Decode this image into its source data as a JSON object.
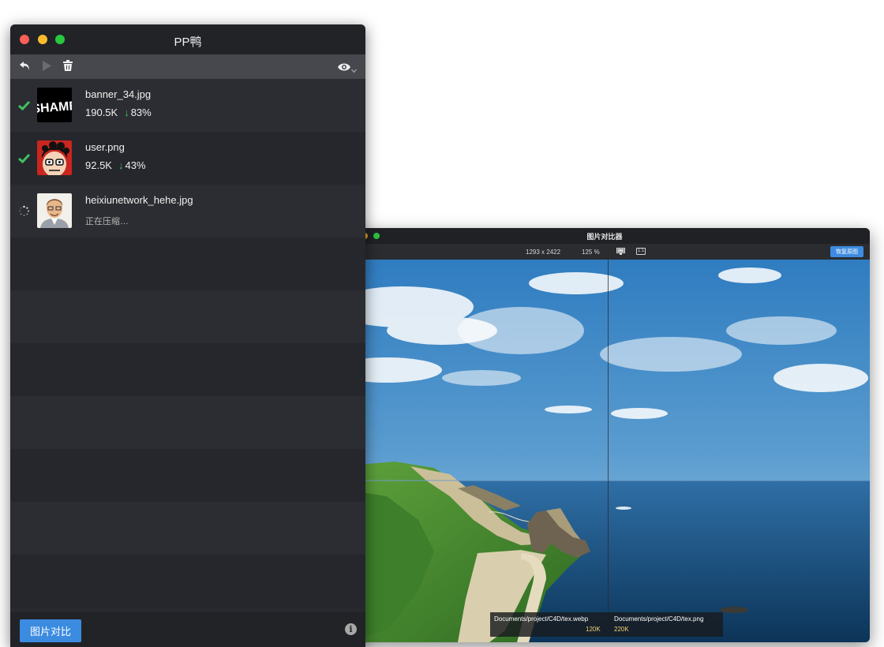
{
  "main_window": {
    "title": "PP鸭",
    "toolbar": {
      "icons": [
        "undo-icon",
        "play-icon",
        "trash-icon",
        "eye-icon",
        "chevron-down-icon"
      ]
    },
    "files": [
      {
        "name": "banner_34.jpg",
        "size": "190.5K",
        "reduction": "83%",
        "status": "done",
        "thumb": "shame-logo"
      },
      {
        "name": "user.png",
        "size": "92.5K",
        "reduction": "43%",
        "status": "done",
        "thumb": "cartoon-face"
      },
      {
        "name": "heixiunetwork_hehe.jpg",
        "status": "compressing",
        "status_text": "正在压缩…",
        "thumb": "portrait-sketch"
      }
    ],
    "thumb_texts": {
      "shame": "SHAME"
    },
    "compare_button": "图片对比",
    "info_icon": "i",
    "colors": {
      "accent": "#3b8be0",
      "success": "#3fc060"
    }
  },
  "compare_window": {
    "title": "图片对比器",
    "dimensions": "1293 x 2422",
    "zoom": "125 %",
    "one_to_one": "1:1",
    "restore_button": "恢复原图",
    "left_file": {
      "path": "Documents/project/C4D/tex.webp",
      "size": "120K"
    },
    "right_file": {
      "path": "Documents/project/C4D/tex.png",
      "size": "220K"
    }
  }
}
